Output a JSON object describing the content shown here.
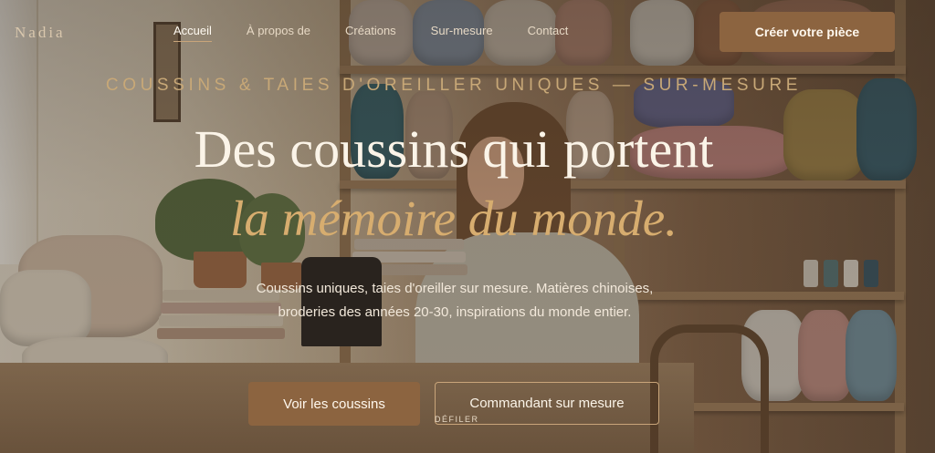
{
  "brand": {
    "name": "Nadia"
  },
  "nav": {
    "items": [
      {
        "label": "Accueil",
        "active": true
      },
      {
        "label": "À propos de",
        "active": false
      },
      {
        "label": "Créations",
        "active": false
      },
      {
        "label": "Sur-mesure",
        "active": false
      },
      {
        "label": "Contact",
        "active": false
      }
    ],
    "cta": "Créer votre pièce"
  },
  "hero": {
    "kicker": "COUSSINS & TAIES D'OREILLER UNIQUES — SUR-MESURE",
    "title": "Des coussins qui portent",
    "title_emphasis": "la mémoire du monde.",
    "lead": "Coussins uniques, taies d'oreiller sur mesure. Matières chinoises, broderies des années 20-30, inspirations du monde entier.",
    "primary_button": "Voir les coussins",
    "secondary_button": "Commandant sur mesure",
    "scroll_hint": "DÉFILER"
  },
  "colors": {
    "accent": "#8c6440",
    "gold": "#d7ad6f",
    "text_light": "#fbf4e8"
  }
}
